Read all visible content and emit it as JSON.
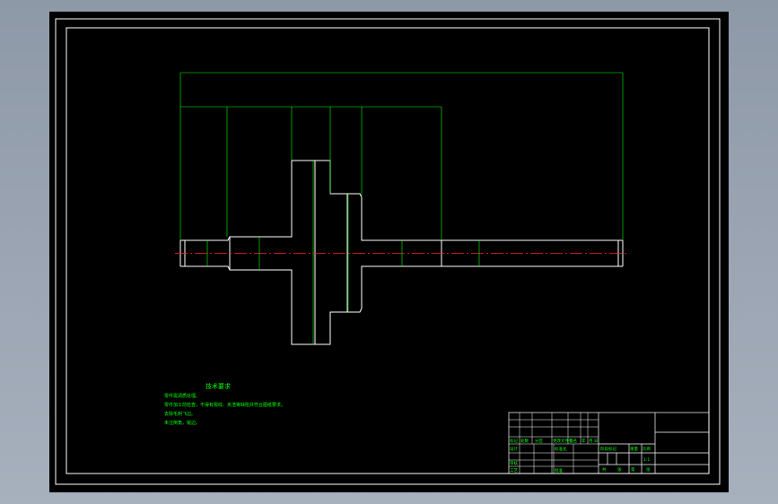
{
  "colors": {
    "background": "#000000",
    "outline": "#ffffff",
    "dimension": "#00ff00",
    "centerline": "#ff2020",
    "workspace": "#9aa4b3"
  },
  "drawing": {
    "dimensions": {
      "overall": "",
      "segments": [
        "",
        "",
        "",
        "",
        ""
      ]
    }
  },
  "notes": {
    "title": "技术要求",
    "lines": [
      "零件需调质处理。",
      "零件加工前检查，不得有裂纹、夹渣等缺陷并符合图纸要求。",
      "去除毛刺飞边。",
      "未注倒角，锐边。"
    ]
  },
  "title_block": {
    "revision_labels": [
      "标记",
      "处数",
      "分区",
      "更改文件号",
      "签名",
      "年",
      "月",
      "日"
    ],
    "role_labels": [
      "设计",
      "标准化",
      "审核",
      "工艺",
      "批准"
    ],
    "stage_label": "阶段标记",
    "weight_label": "重量",
    "scale_label": "比例",
    "scale_value": "1:1",
    "sheet_labels": [
      "共",
      "张",
      "第",
      "张"
    ]
  }
}
